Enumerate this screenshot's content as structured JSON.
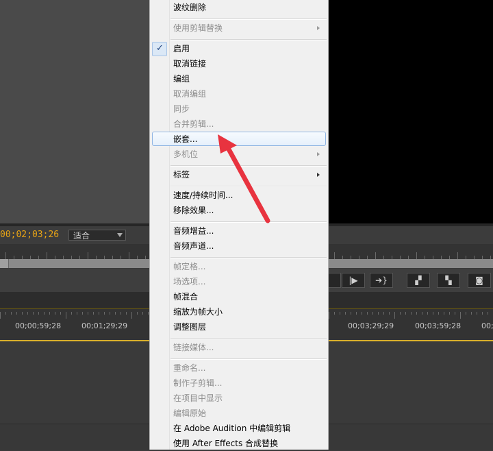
{
  "player": {
    "timecode": "00;02;03;26",
    "fit_label": "适合"
  },
  "timeline": {
    "labels": [
      "00;00;59;28",
      "00;01;29;29",
      "00;03;29;29",
      "00;03;59;28",
      "00;0"
    ]
  },
  "menu": {
    "items": [
      {
        "label": "波纹删除",
        "enabled": true
      },
      {
        "label": "使用剪辑替换",
        "enabled": false,
        "submenu": true
      },
      {
        "label": "启用",
        "enabled": true,
        "checked": true
      },
      {
        "label": "取消链接",
        "enabled": true
      },
      {
        "label": "编组",
        "enabled": true
      },
      {
        "label": "取消编组",
        "enabled": false
      },
      {
        "label": "同步",
        "enabled": false
      },
      {
        "label": "合并剪辑...",
        "enabled": false
      },
      {
        "label": "嵌套...",
        "enabled": true,
        "highlighted": true
      },
      {
        "label": "多机位",
        "enabled": false,
        "submenu": true
      },
      {
        "label": "标签",
        "enabled": true,
        "submenu": true
      },
      {
        "label": "速度/持续时间...",
        "enabled": true
      },
      {
        "label": "移除效果...",
        "enabled": true
      },
      {
        "label": "音频增益...",
        "enabled": true
      },
      {
        "label": "音频声道...",
        "enabled": true
      },
      {
        "label": "帧定格...",
        "enabled": false
      },
      {
        "label": "场选项...",
        "enabled": false
      },
      {
        "label": "帧混合",
        "enabled": true
      },
      {
        "label": "缩放为帧大小",
        "enabled": true
      },
      {
        "label": "调整图层",
        "enabled": true
      },
      {
        "label": "链接媒体...",
        "enabled": false
      },
      {
        "label": "重命名...",
        "enabled": false
      },
      {
        "label": "制作子剪辑...",
        "enabled": false
      },
      {
        "label": "在项目中显示",
        "enabled": false
      },
      {
        "label": "编辑原始",
        "enabled": false
      },
      {
        "label": "在 Adobe Audition 中编辑剪辑",
        "enabled": true
      },
      {
        "label": "使用 After Effects 合成替换",
        "enabled": true
      }
    ]
  },
  "colors": {
    "timecode": "#e8a415",
    "annotation_arrow": "#e8333f"
  }
}
